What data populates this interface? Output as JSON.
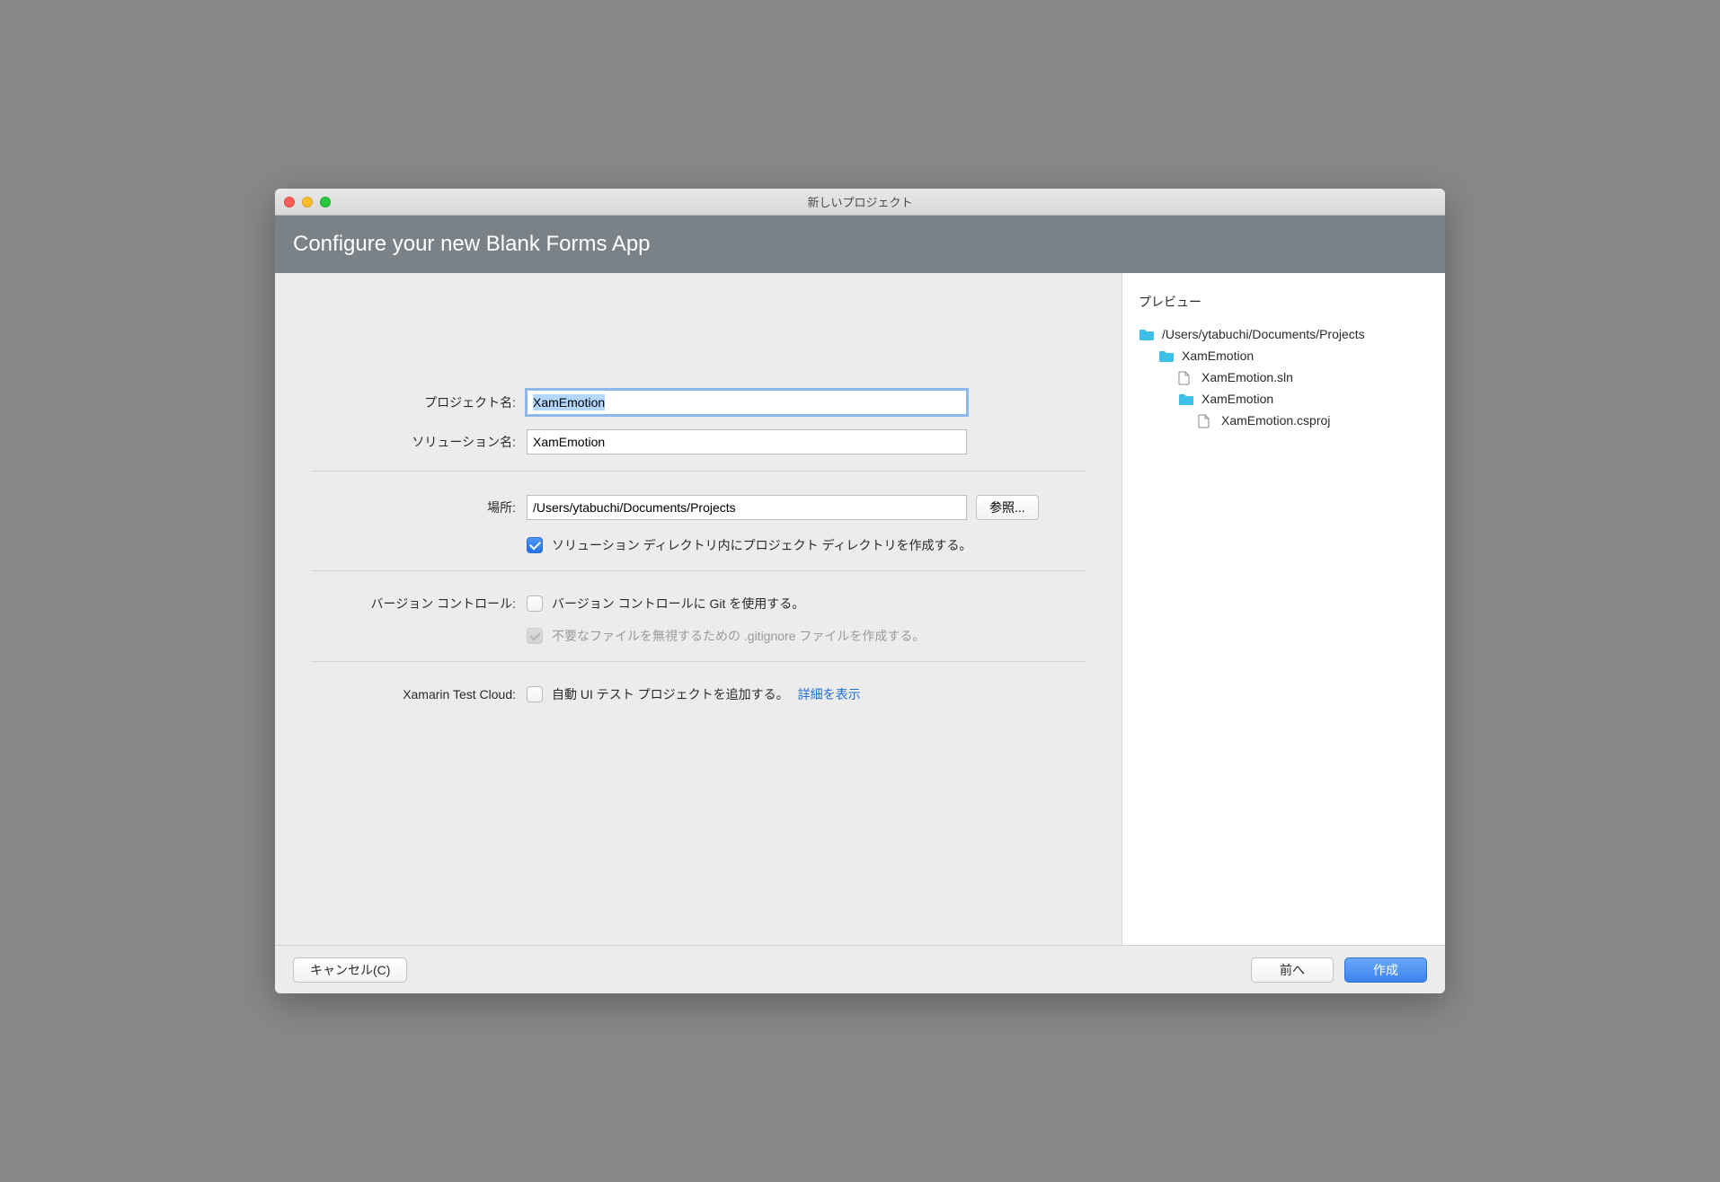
{
  "window": {
    "title": "新しいプロジェクト"
  },
  "header": {
    "title": "Configure your new Blank Forms App"
  },
  "form": {
    "projectName": {
      "label": "プロジェクト名:",
      "value": "XamEmotion"
    },
    "solutionName": {
      "label": "ソリューション名:",
      "value": "XamEmotion"
    },
    "location": {
      "label": "場所:",
      "value": "/Users/ytabuchi/Documents/Projects",
      "browse": "参照..."
    },
    "createSolutionDir": {
      "checked": true,
      "label": "ソリューション ディレクトリ内にプロジェクト ディレクトリを作成する。"
    },
    "versionControl": {
      "label": "バージョン コントロール:",
      "useGit": {
        "checked": false,
        "label": "バージョン コントロールに Git を使用する。"
      },
      "gitignore": {
        "checked": true,
        "disabled": true,
        "label": "不要なファイルを無視するための .gitignore ファイルを作成する。"
      }
    },
    "testCloud": {
      "label": "Xamarin Test Cloud:",
      "addUiTest": {
        "checked": false,
        "label": "自動 UI テスト プロジェクトを追加する。"
      },
      "detailsLink": "詳細を表示"
    }
  },
  "preview": {
    "title": "プレビュー",
    "tree": {
      "root": "/Users/ytabuchi/Documents/Projects",
      "l1_folder": "XamEmotion",
      "l2_file": "XamEmotion.sln",
      "l2_folder": "XamEmotion",
      "l3_file": "XamEmotion.csproj"
    }
  },
  "footer": {
    "cancel": "キャンセル(C)",
    "back": "前へ",
    "create": "作成"
  }
}
